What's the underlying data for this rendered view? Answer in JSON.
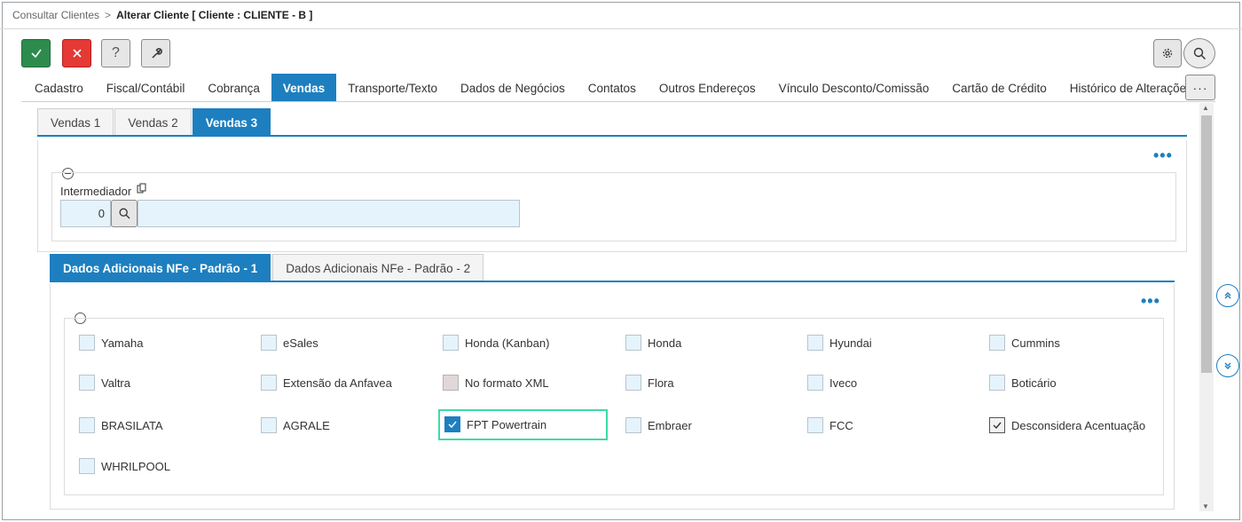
{
  "breadcrumb": {
    "parent": "Consultar Clientes",
    "separator": ">",
    "current": "Alterar Cliente [ Cliente : CLIENTE - B ]"
  },
  "toolbar": {
    "help_label": "?"
  },
  "main_tabs": [
    {
      "label": "Cadastro",
      "active": false
    },
    {
      "label": "Fiscal/Contábil",
      "active": false
    },
    {
      "label": "Cobrança",
      "active": false
    },
    {
      "label": "Vendas",
      "active": true
    },
    {
      "label": "Transporte/Texto",
      "active": false
    },
    {
      "label": "Dados de Negócios",
      "active": false
    },
    {
      "label": "Contatos",
      "active": false
    },
    {
      "label": "Outros Endereços",
      "active": false
    },
    {
      "label": "Vínculo Desconto/Comissão",
      "active": false
    },
    {
      "label": "Cartão de Crédito",
      "active": false
    },
    {
      "label": "Histórico de Alterações",
      "active": false
    }
  ],
  "more_tabs_label": "···",
  "sub_tabs": [
    {
      "label": "Vendas 1",
      "active": false
    },
    {
      "label": "Vendas 2",
      "active": false
    },
    {
      "label": "Vendas 3",
      "active": true
    }
  ],
  "panel_menu": "•••",
  "intermediador": {
    "label": "Intermediador",
    "code": "0",
    "description": ""
  },
  "nfe_tabs": [
    {
      "label": "Dados Adicionais NFe - Padrão - 1",
      "active": true
    },
    {
      "label": "Dados Adicionais NFe - Padrão - 2",
      "active": false
    }
  ],
  "checkboxes": [
    {
      "label": "Yamaha",
      "state": "unchecked"
    },
    {
      "label": "eSales",
      "state": "unchecked"
    },
    {
      "label": "Honda (Kanban)",
      "state": "unchecked"
    },
    {
      "label": "Honda",
      "state": "unchecked"
    },
    {
      "label": "Hyundai",
      "state": "unchecked"
    },
    {
      "label": "Cummins",
      "state": "unchecked"
    },
    {
      "label": "Valtra",
      "state": "unchecked"
    },
    {
      "label": "Extensão da Anfavea",
      "state": "unchecked"
    },
    {
      "label": "No formato XML",
      "state": "disabled"
    },
    {
      "label": "Flora",
      "state": "unchecked"
    },
    {
      "label": "Iveco",
      "state": "unchecked"
    },
    {
      "label": "Boticário",
      "state": "unchecked"
    },
    {
      "label": "BRASILATA",
      "state": "unchecked"
    },
    {
      "label": "AGRALE",
      "state": "unchecked"
    },
    {
      "label": "FPT Powertrain",
      "state": "checked-focused"
    },
    {
      "label": "Embraer",
      "state": "unchecked"
    },
    {
      "label": "FCC",
      "state": "unchecked"
    },
    {
      "label": "Desconsidera Acentuação",
      "state": "checked"
    },
    {
      "label": "WHRILPOOL",
      "state": "unchecked"
    }
  ],
  "colors": {
    "accent": "#1d7fbf",
    "ok": "#2e8b4e",
    "cancel": "#e53935",
    "input_bg": "#e5f4fc",
    "focus": "#3ddba8"
  }
}
